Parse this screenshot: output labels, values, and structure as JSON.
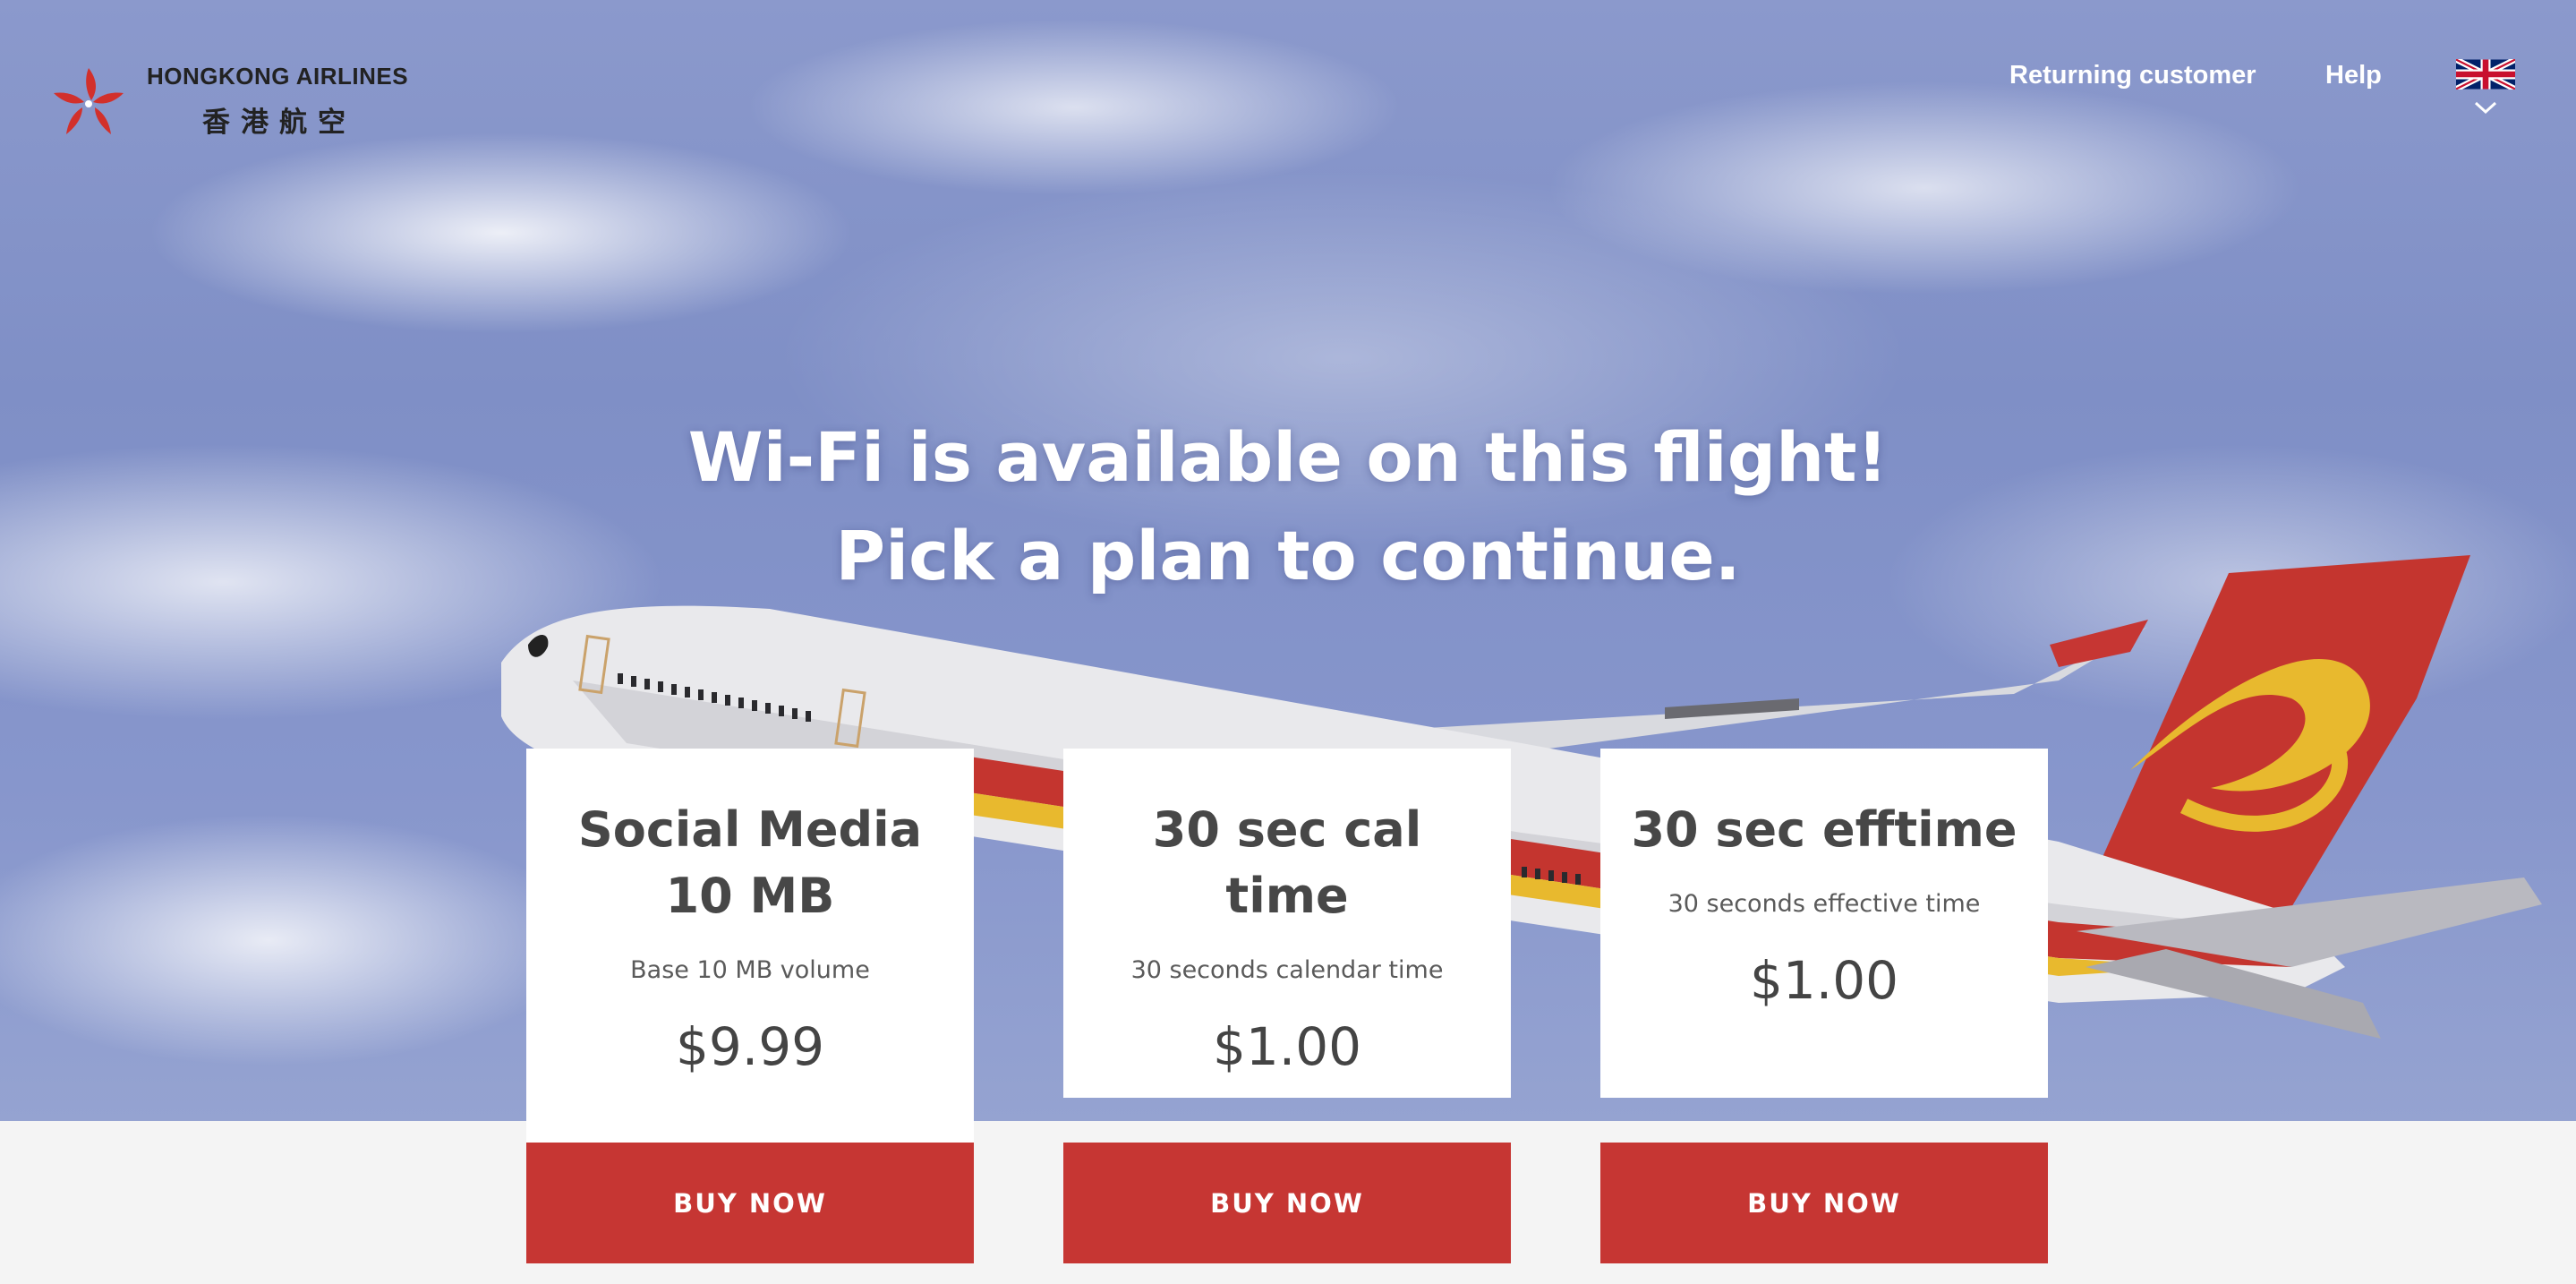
{
  "brand": {
    "name_en": "HONGKONG AIRLINES",
    "name_zh": "香港航空"
  },
  "nav": {
    "returning_customer": "Returning customer",
    "help": "Help",
    "language_icon": "uk-flag-icon"
  },
  "hero": {
    "line1": "Wi-Fi is available on this flight!",
    "line2": "Pick a plan to continue."
  },
  "plans": [
    {
      "name": "Social Media 10 MB",
      "description": "Base 10 MB volume",
      "price": "$9.99",
      "cta": "BUY NOW"
    },
    {
      "name": "30 sec cal time",
      "description": "30 seconds calendar time",
      "price": "$1.00",
      "cta": "BUY NOW"
    },
    {
      "name": "30 sec efftime",
      "description": "30 seconds effective time",
      "price": "$1.00",
      "cta": "BUY NOW"
    }
  ],
  "colors": {
    "brand_red": "#c63633",
    "text_dark": "#444444",
    "sky": "#8796cc"
  }
}
